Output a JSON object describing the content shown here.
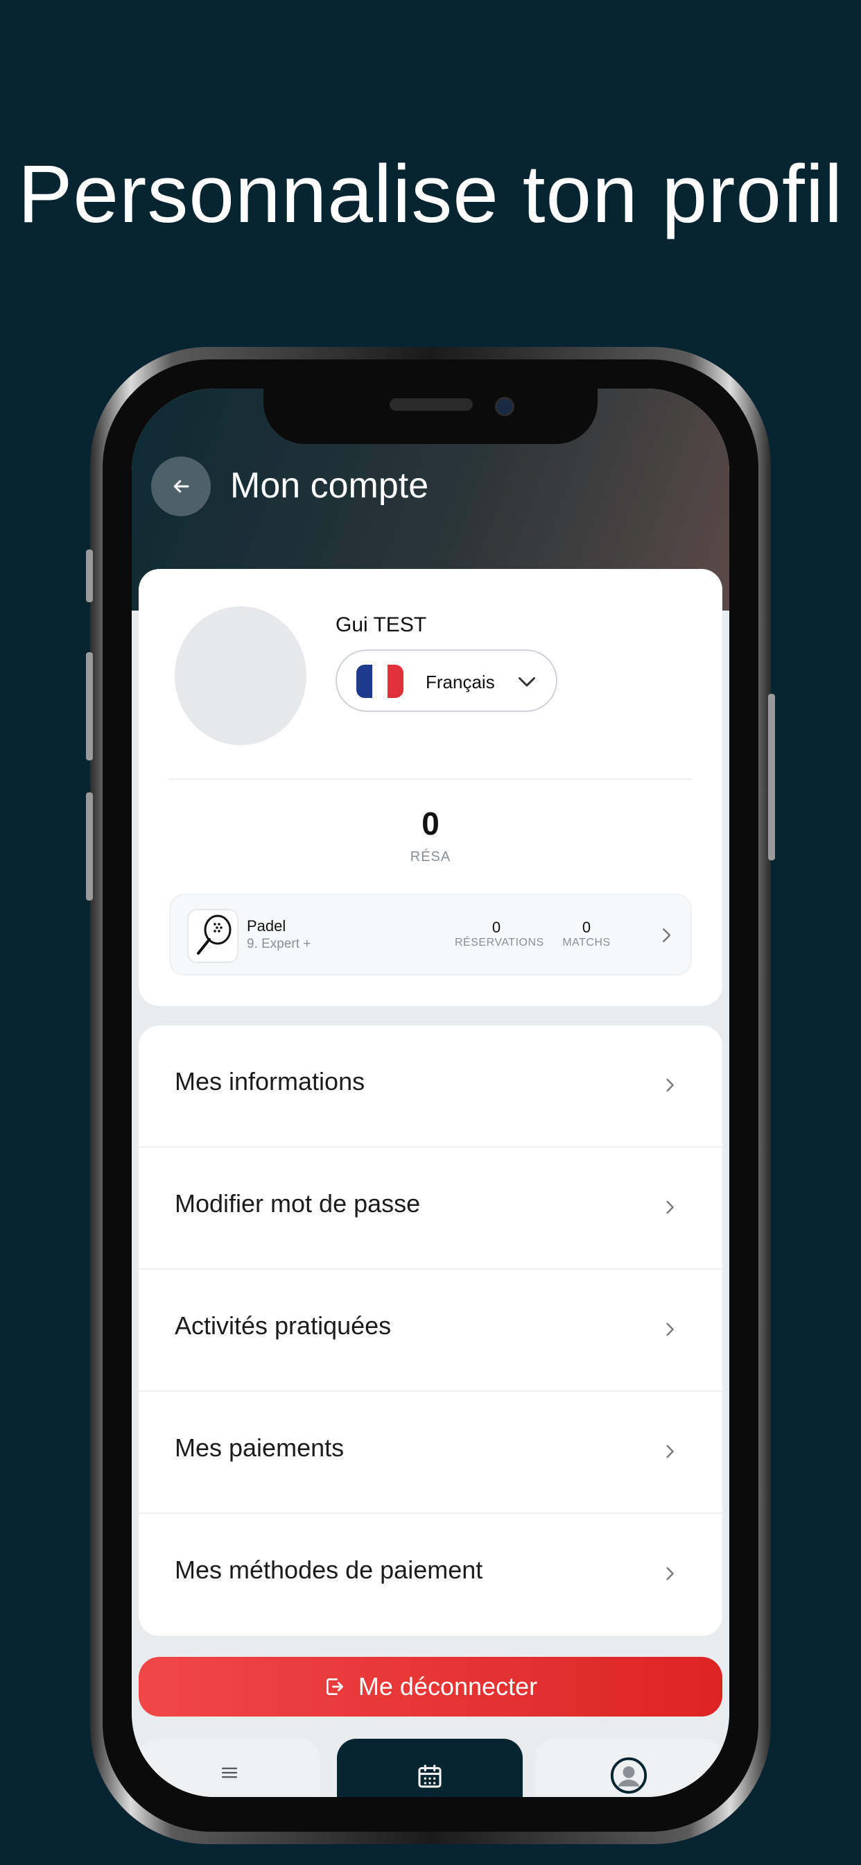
{
  "promo": {
    "headline": "Personnalise ton profil"
  },
  "header": {
    "title": "Mon compte",
    "back_icon": "arrow-left-icon"
  },
  "profile": {
    "name": "Gui  TEST",
    "language": {
      "label": "Français",
      "flag": "france-flag-icon"
    },
    "resa": {
      "count": "0",
      "label": "RÉSA"
    }
  },
  "sport": {
    "icon": "padel-racket-icon",
    "name": "Padel",
    "level": "9. Expert +",
    "reservations": {
      "value": "0",
      "label": "RÉSERVATIONS"
    },
    "matchs": {
      "value": "0",
      "label": "MATCHS"
    }
  },
  "menu": {
    "items": [
      {
        "label": "Mes informations"
      },
      {
        "label": "Modifier mot de passe"
      },
      {
        "label": "Activités pratiquées"
      },
      {
        "label": "Mes paiements"
      },
      {
        "label": "Mes méthodes de paiement"
      }
    ]
  },
  "logout": {
    "label": "Me déconnecter",
    "icon": "logout-icon"
  },
  "tabbar": {
    "tabs": [
      "menu-icon",
      "calendar-icon",
      "user-icon"
    ],
    "active_index": 1
  },
  "colors": {
    "background": "#062530",
    "accent_red": "#e23232",
    "active_tab": "#062530"
  }
}
